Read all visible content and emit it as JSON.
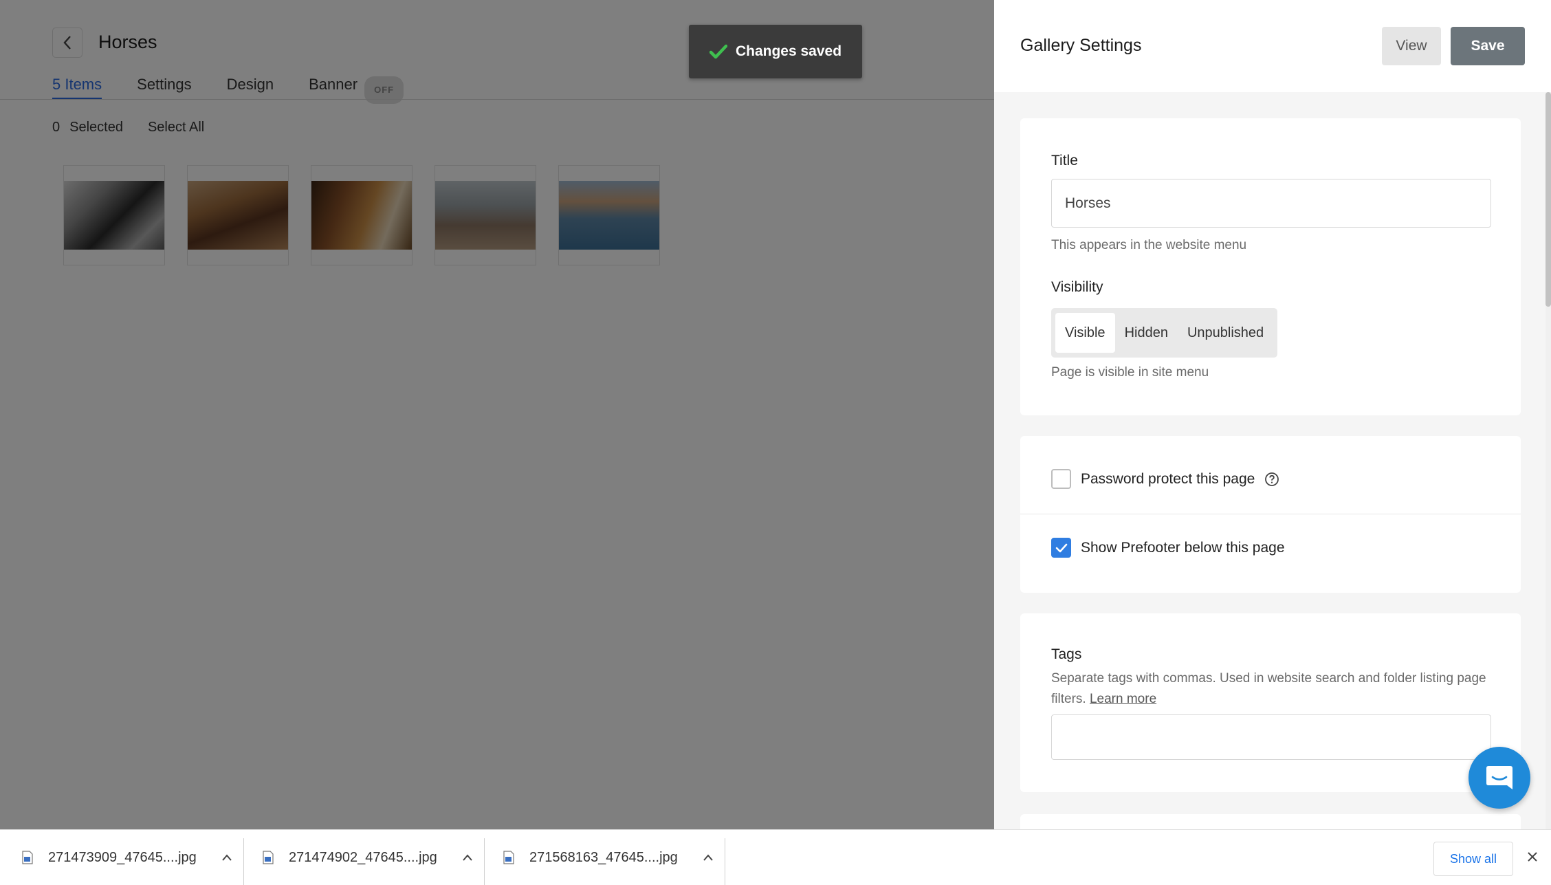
{
  "editor": {
    "title": "Horses",
    "tabs": [
      {
        "label": "5 Items",
        "active": true
      },
      {
        "label": "Settings",
        "active": false
      },
      {
        "label": "Design",
        "active": false
      },
      {
        "label": "Banner",
        "active": false
      }
    ],
    "banner_toggle": "OFF",
    "selected_count": "0",
    "selected_label": "Selected",
    "select_all": "Select All",
    "thumbnails": [
      "horse-photo-1",
      "horse-photo-2",
      "horse-photo-3",
      "horse-photo-4",
      "horse-photo-5"
    ]
  },
  "toast": {
    "message": "Changes saved",
    "icon": "check-icon",
    "icon_color": "#3fbf4f"
  },
  "panel": {
    "title": "Gallery Settings",
    "view_label": "View",
    "save_label": "Save",
    "title_field": {
      "label": "Title",
      "value": "Horses",
      "help": "This appears in the website menu"
    },
    "visibility": {
      "label": "Visibility",
      "options": [
        "Visible",
        "Hidden",
        "Unpublished"
      ],
      "selected": "Visible",
      "help": "Page is visible in site menu"
    },
    "password": {
      "label": "Password protect this page",
      "checked": false,
      "icon": "help-circle-icon"
    },
    "prefooter": {
      "label": "Show Prefooter below this page",
      "checked": true
    },
    "tags": {
      "label": "Tags",
      "help": "Separate tags with commas. Used in website search and folder listing page filters.",
      "learn_more": "Learn more",
      "value": ""
    },
    "accent_color": "#2f7de1",
    "chat_color": "#1f8ad9"
  },
  "downloads": {
    "items": [
      {
        "name": "271473909_47645....jpg"
      },
      {
        "name": "271474902_47645....jpg"
      },
      {
        "name": "271568163_47645....jpg"
      }
    ],
    "show_all": "Show all"
  }
}
